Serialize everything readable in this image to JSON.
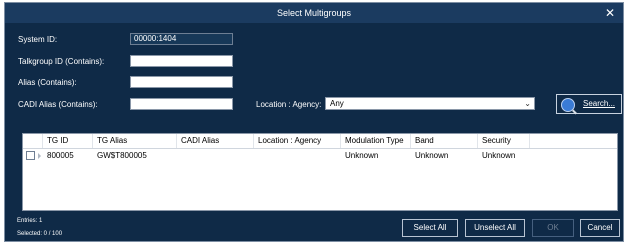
{
  "window": {
    "title": "Select Multigroups",
    "close_glyph": "✕"
  },
  "form": {
    "system_id": {
      "label": "System ID:",
      "value": "00000:1404"
    },
    "talkgroup_id": {
      "label": "Talkgroup ID (Contains):",
      "value": ""
    },
    "alias": {
      "label": "Alias (Contains):",
      "value": ""
    },
    "cadi_alias": {
      "label": "CADI Alias (Contains):",
      "value": ""
    },
    "location_agency": {
      "label": "Location : Agency:",
      "value": "Any"
    },
    "search_label": "Search..."
  },
  "grid": {
    "columns": [
      "TG ID",
      "TG Alias",
      "CADI Alias",
      "Location : Agency",
      "Modulation Type",
      "Band",
      "Security"
    ],
    "rows": [
      {
        "tg_id": "800005",
        "tg_alias": "GW$T800005",
        "cadi_alias": "",
        "location_agency": "",
        "modulation_type": "Unknown",
        "band": "Unknown",
        "security": "Unknown"
      }
    ]
  },
  "footer": {
    "entries": "Entries: 1",
    "selected": "Selected: 0 / 100",
    "select_all": "Select All",
    "unselect_all": "Unselect All",
    "ok": "OK",
    "cancel": "Cancel"
  },
  "colors": {
    "window_bg": "#0f2a47",
    "title_bg": "#1b3b60",
    "accent": "#3a7bd5"
  },
  "icons": {
    "search": "magnifier-icon",
    "close": "close-icon",
    "dropdown": "chevron-down-icon"
  }
}
